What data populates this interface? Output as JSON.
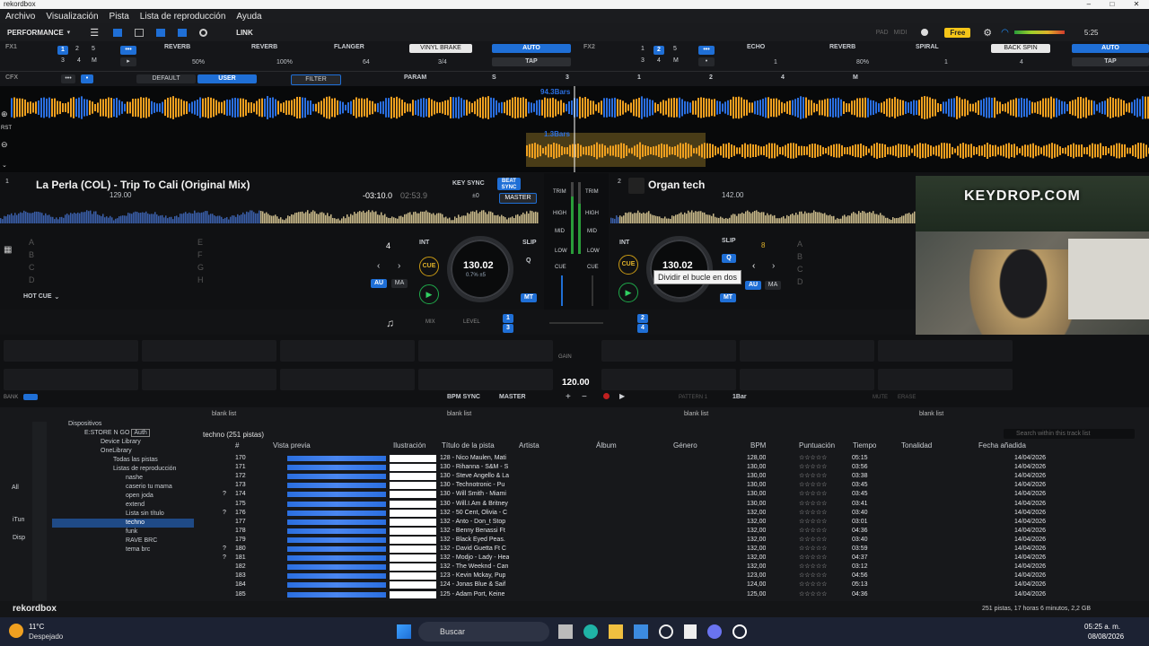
{
  "window": {
    "title": "rekordbox"
  },
  "menu": [
    "Archivo",
    "Visualización",
    "Pista",
    "Lista de reproducción",
    "Ayuda"
  ],
  "toolbar": {
    "mode": "PERFORMANCE",
    "link": "LINK",
    "pad": "PAD",
    "midi": "MIDI",
    "plan": "Free",
    "time": "5:25"
  },
  "fx1": {
    "label": "FX1",
    "beat_buttons": [
      "1",
      "2",
      "3",
      "4",
      "5",
      "M"
    ],
    "slot1": "REVERB",
    "slot2": "REVERB",
    "slot3": "FLANGER",
    "beat_fx": "VINYL BRAKE",
    "auto": "AUTO",
    "tap": "TAP",
    "v1": "50%",
    "v2": "100%",
    "v3": "64",
    "beat": "3/4"
  },
  "fx2": {
    "label": "FX2",
    "beat_buttons": [
      "1",
      "2",
      "3",
      "4",
      "5",
      "M"
    ],
    "slot1": "ECHO",
    "slot2": "REVERB",
    "slot3": "SPIRAL",
    "beat_fx": "BACK SPIN",
    "auto": "AUTO",
    "tap": "TAP",
    "v1": "1",
    "v2": "80%",
    "v3": "1",
    "beat": "4"
  },
  "cfx": {
    "label": "CFX",
    "default": "DEFAULT",
    "user": "USER",
    "filter": "FILTER",
    "param": "PARAM",
    "s": "S",
    "nums": [
      "1",
      "2",
      "3",
      "4",
      "M"
    ]
  },
  "waveform": {
    "bars_top": "94.3Bars",
    "bars_bottom": "1.3Bars",
    "rst": "RST"
  },
  "deck1": {
    "num": "1",
    "title": "La Perla (COL) - Trip To Cali (Original Mix)",
    "bpm": "129.00",
    "keysync": "KEY SYNC",
    "beatsync": "BEAT SYNC",
    "master": "MASTER",
    "key_offset": "±0",
    "remaining": "-03:10.0",
    "elapsed": "02:53.9",
    "jog_bpm": "130.02",
    "jog_sub": "0.7% ±5",
    "loop_beats": "4",
    "int": "INT",
    "slip": "SLIP",
    "q": "Q",
    "cue": "CUE",
    "au": "AU",
    "ma": "MA",
    "mt": "MT",
    "hotcue": "HOT CUE",
    "pads_left": [
      "A",
      "B",
      "C",
      "D"
    ],
    "pads_right": [
      "E",
      "F",
      "G",
      "H"
    ]
  },
  "deck2": {
    "num": "2",
    "title": "Organ tech",
    "bpm": "142.00",
    "jog_bpm": "130.02",
    "loop_beats": "8",
    "int": "INT",
    "slip": "SLIP",
    "q": "Q",
    "cue": "CUE",
    "au": "AU",
    "ma": "MA",
    "mt": "MT",
    "tooltip": "Dividir el bucle en dos",
    "pads": [
      "A",
      "B",
      "C",
      "D"
    ]
  },
  "mixer": {
    "trim": "TRIM",
    "high": "HIGH",
    "mid": "MID",
    "low": "LOW",
    "cue": "CUE",
    "mix": "MIX",
    "level": "LEVEL",
    "gain": "GAIN",
    "master_bpm": "120.00"
  },
  "sampler": {
    "bank": "BANK",
    "bpm_sync": "BPM SYNC",
    "master": "MASTER",
    "pattern": "PATTERN 1",
    "bar": "1Bar",
    "mute": "MUTE",
    "erase": "ERASE"
  },
  "browser": {
    "lists": [
      "blank list",
      "blank list",
      "blank list",
      "blank list"
    ],
    "playlist_header": "techno (251 pistas)",
    "search_placeholder": "Search within this track list",
    "tree": [
      "Dispositivos",
      "E:STORE N GO",
      "Auth",
      "Device Library",
      "OneLibrary",
      "Todas las pistas",
      "Listas de reproducción",
      "nashe",
      "caserio tu mama",
      "open joda",
      "extend",
      "Lista sin título",
      "techno",
      "funk",
      "RAVE BRC",
      "tema brc"
    ],
    "side": [
      "All",
      "iTun",
      "Disp"
    ],
    "columns": [
      "#",
      "Vista previa",
      "Ilustración",
      "Título de la pista",
      "Artista",
      "Álbum",
      "Género",
      "BPM",
      "Puntuación",
      "Tiempo",
      "Tonalidad",
      "Fecha añadida"
    ],
    "rows": [
      {
        "n": "170",
        "title": "128 - Nico Maulen, Mati",
        "bpm": "128,00",
        "time": "05:15",
        "date": "14/04/2026",
        "q": ""
      },
      {
        "n": "171",
        "title": "130 - Rihanna - S&M - S",
        "bpm": "130,00",
        "time": "03:56",
        "date": "14/04/2026",
        "q": ""
      },
      {
        "n": "172",
        "title": "130 - Steve Angello & La",
        "bpm": "130,00",
        "time": "03:38",
        "date": "14/04/2026",
        "q": ""
      },
      {
        "n": "173",
        "title": "130 - Technotronic - Pu",
        "bpm": "130,00",
        "time": "03:45",
        "date": "14/04/2026",
        "q": ""
      },
      {
        "n": "174",
        "title": "130 - Will Smith - Miami",
        "bpm": "130,00",
        "time": "03:45",
        "date": "14/04/2026",
        "q": "?"
      },
      {
        "n": "175",
        "title": "130 - Will.I.Am & Britney",
        "bpm": "130,00",
        "time": "03:41",
        "date": "14/04/2026",
        "q": ""
      },
      {
        "n": "176",
        "title": "132 - 50 Cent, Olivia - C",
        "bpm": "132,00",
        "time": "03:40",
        "date": "14/04/2026",
        "q": "?"
      },
      {
        "n": "177",
        "title": "132 - Anto - Don_t Stop",
        "bpm": "132,00",
        "time": "03:01",
        "date": "14/04/2026",
        "q": ""
      },
      {
        "n": "178",
        "title": "132 - Benny Benassi Ft",
        "bpm": "132,00",
        "time": "04:36",
        "date": "14/04/2026",
        "q": ""
      },
      {
        "n": "179",
        "title": "132 - Black Eyed Peas.",
        "bpm": "132,00",
        "time": "03:40",
        "date": "14/04/2026",
        "q": ""
      },
      {
        "n": "180",
        "title": "132 - David Guetta Ft C",
        "bpm": "132,00",
        "time": "03:59",
        "date": "14/04/2026",
        "q": "?"
      },
      {
        "n": "181",
        "title": "132 - Modjo - Lady - Hea",
        "bpm": "132,00",
        "time": "04:37",
        "date": "14/04/2026",
        "q": "?"
      },
      {
        "n": "182",
        "title": "132 - The Weeknd - Can",
        "bpm": "132,00",
        "time": "03:12",
        "date": "14/04/2026",
        "q": ""
      },
      {
        "n": "183",
        "title": "123 - Kevin Mckay, Pup",
        "bpm": "123,00",
        "time": "04:56",
        "date": "14/04/2026",
        "q": ""
      },
      {
        "n": "184",
        "title": "124 - Jonas Blue & Saif",
        "bpm": "124,00",
        "time": "05:13",
        "date": "14/04/2026",
        "q": ""
      },
      {
        "n": "185",
        "title": "125 - Adam Port, Keine",
        "bpm": "125,00",
        "time": "04:36",
        "date": "14/04/2026",
        "q": ""
      }
    ]
  },
  "status": {
    "brand": "rekordbox",
    "summary": "251 pistas, 17 horas 6 minutos, 2,2 GB"
  },
  "banner": {
    "text": "KEYDROP.COM"
  },
  "taskbar": {
    "temp": "11°C",
    "weather": "Despejado",
    "search": "Buscar",
    "time": "05:25 a. m.",
    "date": "08/08/2026"
  },
  "colors": {
    "accent": "#1f6fd6",
    "wave_orange": "#f0a020",
    "wave_blue": "#2b6fe0",
    "cue_gold": "#e0b22a",
    "play_green": "#31d062",
    "free_badge": "#f5c518"
  }
}
